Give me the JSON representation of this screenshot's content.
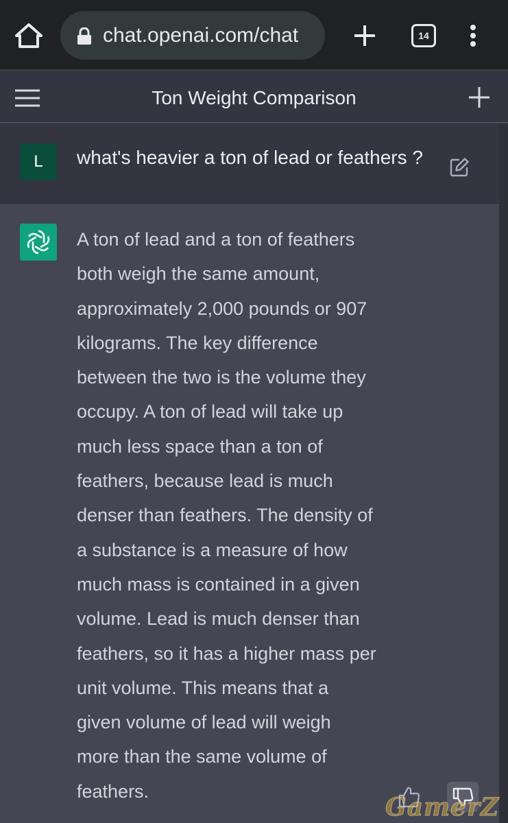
{
  "browser": {
    "url": "chat.openai.com/chat",
    "tab_count": "14",
    "icons": {
      "home": "home-icon",
      "lock": "lock-icon",
      "new_tab": "plus-icon",
      "tabs": "tab-switcher-icon",
      "menu": "kebab-menu-icon"
    }
  },
  "header": {
    "title": "Ton Weight Comparison",
    "icons": {
      "menu": "hamburger-icon",
      "new_chat": "plus-icon"
    }
  },
  "conversation": {
    "user_message": {
      "avatar_initial": "L",
      "text": "what's heavier a ton of lead or feathers ?"
    },
    "assistant_message": {
      "lines": [
        "A ton of lead and a ton of feathers",
        "both weigh the same amount,",
        "approximately 2,000 pounds or 907",
        "kilograms. The key difference",
        "between the two is the volume they",
        "occupy. A ton of lead will take up",
        "much less space than a ton of",
        "feathers, because lead is much",
        "denser than feathers. The density of",
        "a substance is a measure of how",
        "much mass is contained in a given",
        "volume. Lead is much denser than",
        "feathers, so it has a higher mass per",
        "unit volume. This means that a",
        "given volume of lead will weigh",
        "more than the same volume of",
        "feathers."
      ]
    }
  },
  "watermark": "GamerZ",
  "colors": {
    "browser_bar": "#202124",
    "header_bg": "#343541",
    "assistant_bg": "#444654",
    "user_avatar": "#0b4d3b",
    "gpt_avatar": "#10a37f",
    "text": "#d1d5db"
  }
}
